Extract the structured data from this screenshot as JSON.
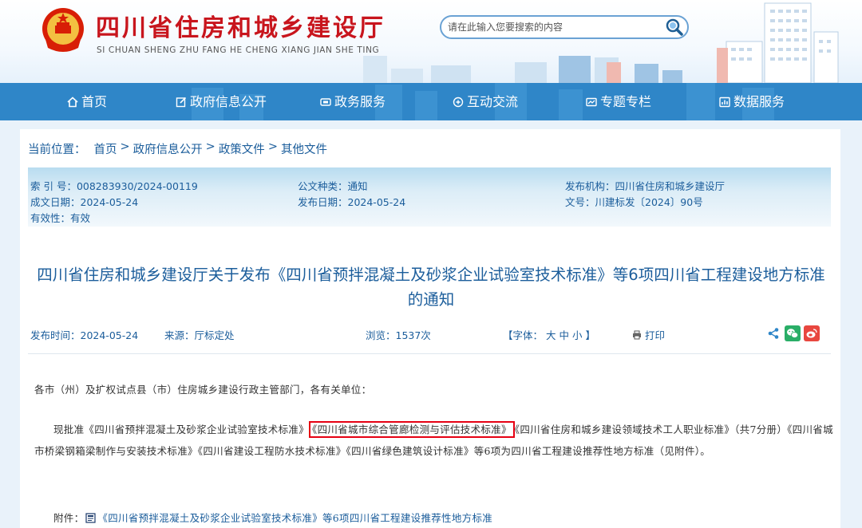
{
  "header": {
    "site_title": "四川省住房和城乡建设厅",
    "site_pinyin": "SI CHUAN SHENG ZHU FANG HE CHENG XIANG JIAN SHE TING",
    "search_placeholder": "请在此输入您要搜索的内容"
  },
  "nav": {
    "items": [
      {
        "label": "首页",
        "icon": "home-icon"
      },
      {
        "label": "政府信息公开",
        "icon": "edit-icon"
      },
      {
        "label": "政务服务",
        "icon": "service-icon"
      },
      {
        "label": "互动交流",
        "icon": "chat-icon"
      },
      {
        "label": "专题专栏",
        "icon": "topic-icon"
      },
      {
        "label": "数据服务",
        "icon": "data-icon"
      }
    ]
  },
  "breadcrumb": {
    "prefix": "当前位置：",
    "items": [
      "首页",
      "政府信息公开",
      "政策文件",
      "其他文件"
    ],
    "separator": ">"
  },
  "meta": {
    "index_no": "索 引 号：008283930/2024-00119",
    "doc_type": "公文种类：通知",
    "issuer": "发布机构：四川省住房和城乡建设厅",
    "created_date": "成文日期：2024-05-24",
    "publish_date": "发布日期：2024-05-24",
    "doc_no": "文号：川建标发〔2024〕90号",
    "validity": "有效性：有效"
  },
  "article": {
    "title": "四川省住房和城乡建设厅关于发布《四川省预拌混凝土及砂浆企业试验室技术标准》等6项四川省工程建设地方标准的通知",
    "publish_time": "发布时间：2024-05-24",
    "source": "来源：厅标定处",
    "views": "浏览：1537次",
    "font_label": "【字体：",
    "font_large": "大",
    "font_medium": "中",
    "font_small": "小",
    "font_close": "】",
    "print_label": "打印",
    "salutation": "各市（州）及扩权试点县（市）住房城乡建设行政主管部门，各有关单位：",
    "body_before": "现批准《四川省预拌混凝土及砂浆企业试验室技术标准》",
    "body_highlight": "《四川省城市综合管廊检测与评估技术标准》",
    "body_after": "《四川省住房和城乡建设领域技术工人职业标准》（共7分册）《四川省城市桥梁钢箱梁制作与安装技术标准》《四川省建设工程防水技术标准》《四川省绿色建筑设计标准》等6项为四川省工程建设推荐性地方标准（见附件）。",
    "attachment_label": "附件：",
    "attachment_link": "《四川省预拌混凝土及砂浆企业试验室技术标准》等6项四川省工程建设推荐性地方标准"
  },
  "colors": {
    "nav_bg": "#2f86c8",
    "title_red": "#c8151d",
    "link_blue": "#1b5d9b",
    "highlight_red": "#e60012"
  }
}
